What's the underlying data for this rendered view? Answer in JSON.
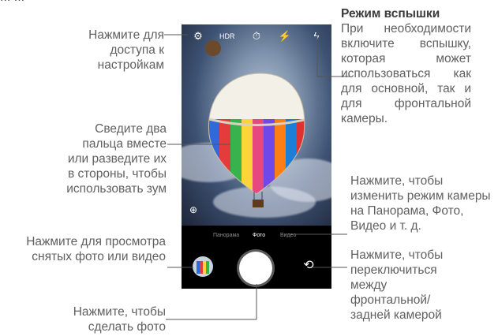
{
  "page_top_text": "... ...",
  "callouts": {
    "settings": "Нажмите для доступа к настройкам",
    "zoom": "Сведите два пальца вместе или разведите их в стороны, чтобы использовать зум",
    "gallery": "Нажмите для просмотра снятых фото или видео",
    "shutter": "Нажмите, чтобы сделать фото",
    "flash_title": "Режим вспышки",
    "flash_body": "При необходимости включите вспышку, которая может использоваться как для основной, так и для фронтальной камеры.",
    "mode": "Нажмите, чтобы изменить режим камеры на Панорама, Фото, Видео и т. д.",
    "switch": "Нажмите, чтобы переключиться между фронтальной/ задней камерой"
  },
  "camera": {
    "modes": [
      "Панорама",
      "Фото",
      "Видео"
    ],
    "active_mode": "Фото",
    "top_icons": [
      "gear-icon",
      "hdr-off-icon",
      "timer-icon",
      "flash-auto-icon",
      "flash-off-icon"
    ]
  },
  "colors": {
    "text": "#606060",
    "line": "#555555",
    "phone_bg": "#000000"
  }
}
